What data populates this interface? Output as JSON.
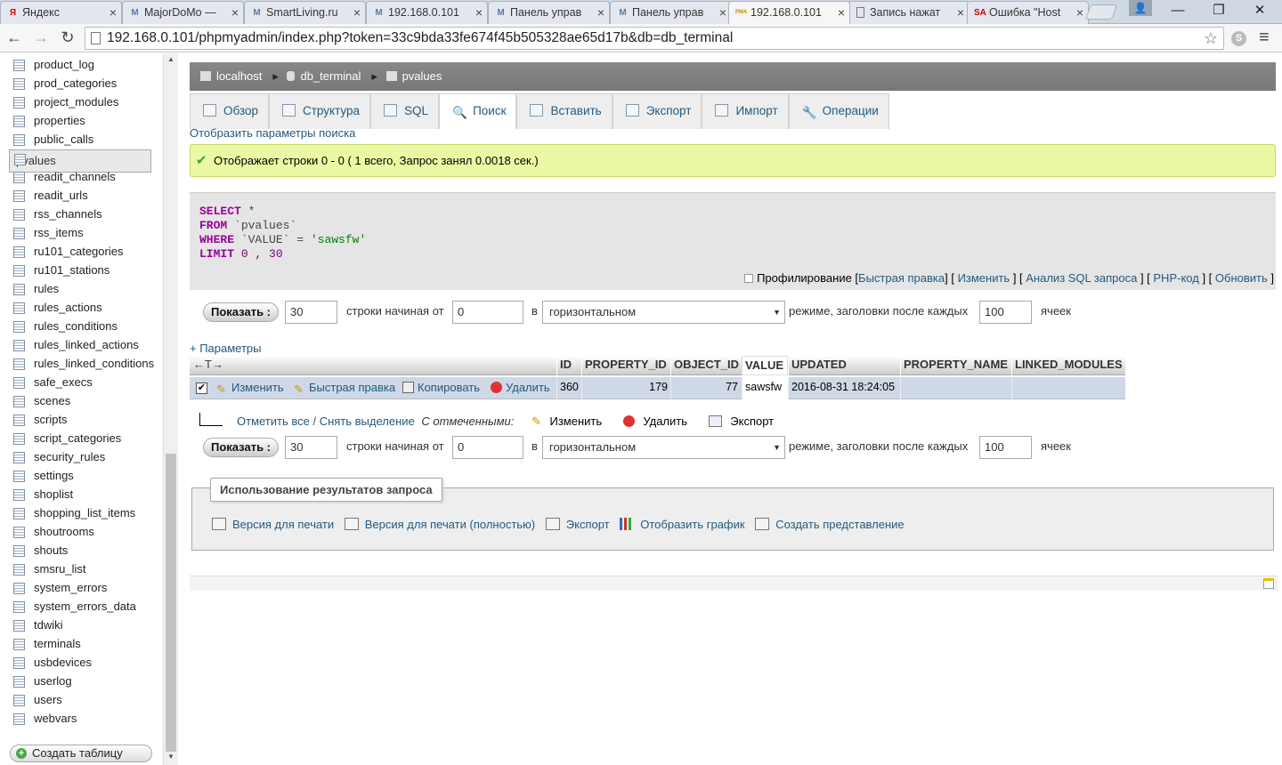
{
  "browser": {
    "tabs": [
      {
        "label": "Яндекс",
        "fav": "Я"
      },
      {
        "label": "MajorDoMo —",
        "fav": "M"
      },
      {
        "label": "SmartLiving.ru",
        "fav": "M"
      },
      {
        "label": "192.168.0.101",
        "fav": "M"
      },
      {
        "label": "Панель управ",
        "fav": "M"
      },
      {
        "label": "Панель управ",
        "fav": "M"
      },
      {
        "label": "192.168.0.101",
        "fav": "PMA"
      },
      {
        "label": "Запись нажат",
        "fav": ""
      },
      {
        "label": "Ошибка \"Host",
        "fav": "SA"
      }
    ],
    "active_tab_index": 6,
    "url": "192.168.0.101/phpmyadmin/index.php?token=33c9bda33fe674f45b505328ae65d17b&db=db_terminal"
  },
  "sidebar": {
    "items": [
      "product_log",
      "prod_categories",
      "project_modules",
      "properties",
      "public_calls",
      "pvalues",
      "readit_channels",
      "readit_urls",
      "rss_channels",
      "rss_items",
      "ru101_categories",
      "ru101_stations",
      "rules",
      "rules_actions",
      "rules_conditions",
      "rules_linked_actions",
      "rules_linked_conditions",
      "safe_execs",
      "scenes",
      "scripts",
      "script_categories",
      "security_rules",
      "settings",
      "shoplist",
      "shopping_list_items",
      "shoutrooms",
      "shouts",
      "smsru_list",
      "system_errors",
      "system_errors_data",
      "tdwiki",
      "terminals",
      "usbdevices",
      "userlog",
      "users",
      "webvars"
    ],
    "selected": "pvalues",
    "create_table": "Создать таблицу"
  },
  "breadcrumb": {
    "server": "localhost",
    "db": "db_terminal",
    "table": "pvalues"
  },
  "tabs": [
    "Обзор",
    "Структура",
    "SQL",
    "Поиск",
    "Вставить",
    "Экспорт",
    "Импорт",
    "Операции"
  ],
  "active_tab": "Поиск",
  "show_search": "Отобразить параметры поиска",
  "success": "Отображает строки 0 - 0 ( 1 всего, Запрос занял 0.0018 сек.)",
  "sql": {
    "l1_kw": "SELECT",
    "l1_rest": " *",
    "l2_kw": "FROM",
    "l2_rest": " `pvalues`",
    "l3_kw": "WHERE",
    "l3_id": " `VALUE`",
    "l3_op": " = ",
    "l3_str": "'sawsfw'",
    "l4_kw": "LIMIT",
    "l4_rest": " 0 , 30"
  },
  "sql_links": {
    "profiling": "Профилирование",
    "inline_edit": "Быстрая правка",
    "edit": "Изменить",
    "explain": "Анализ SQL запроса",
    "php_code": "PHP-код",
    "refresh": "Обновить"
  },
  "nav": {
    "show_button": "Показать :",
    "rows": "30",
    "rows_from_label": "строки начиная от",
    "start": "0",
    "in_label": "в",
    "mode": "горизонтальном",
    "headers_label": "режиме, заголовки после каждых",
    "repeat": "100",
    "cells_label": "ячеек"
  },
  "params_link": "+ Параметры",
  "table": {
    "arrows": "←T→",
    "columns": [
      "ID",
      "PROPERTY_ID",
      "OBJECT_ID",
      "VALUE",
      "UPDATED",
      "PROPERTY_NAME",
      "LINKED_MODULES"
    ],
    "row": {
      "actions": {
        "edit": "Изменить",
        "inline": "Быстрая правка",
        "copy": "Копировать",
        "delete": "Удалить"
      },
      "ID": "360",
      "PROPERTY_ID": "179",
      "OBJECT_ID": "77",
      "VALUE": "sawsfw",
      "UPDATED": "2016-08-31 18:24:05",
      "PROPERTY_NAME": "",
      "LINKED_MODULES": ""
    }
  },
  "with_selected": {
    "check_all": "Отметить все",
    "slash": " / ",
    "uncheck": "Снять выделение",
    "label": "С отмеченными:",
    "edit": "Изменить",
    "delete": "Удалить",
    "export": "Экспорт"
  },
  "query_results": {
    "legend": "Использование результатов запроса",
    "print": "Версия для печати",
    "print_full": "Версия для печати (полностью)",
    "export": "Экспорт",
    "chart": "Отобразить график",
    "view": "Создать представление"
  }
}
